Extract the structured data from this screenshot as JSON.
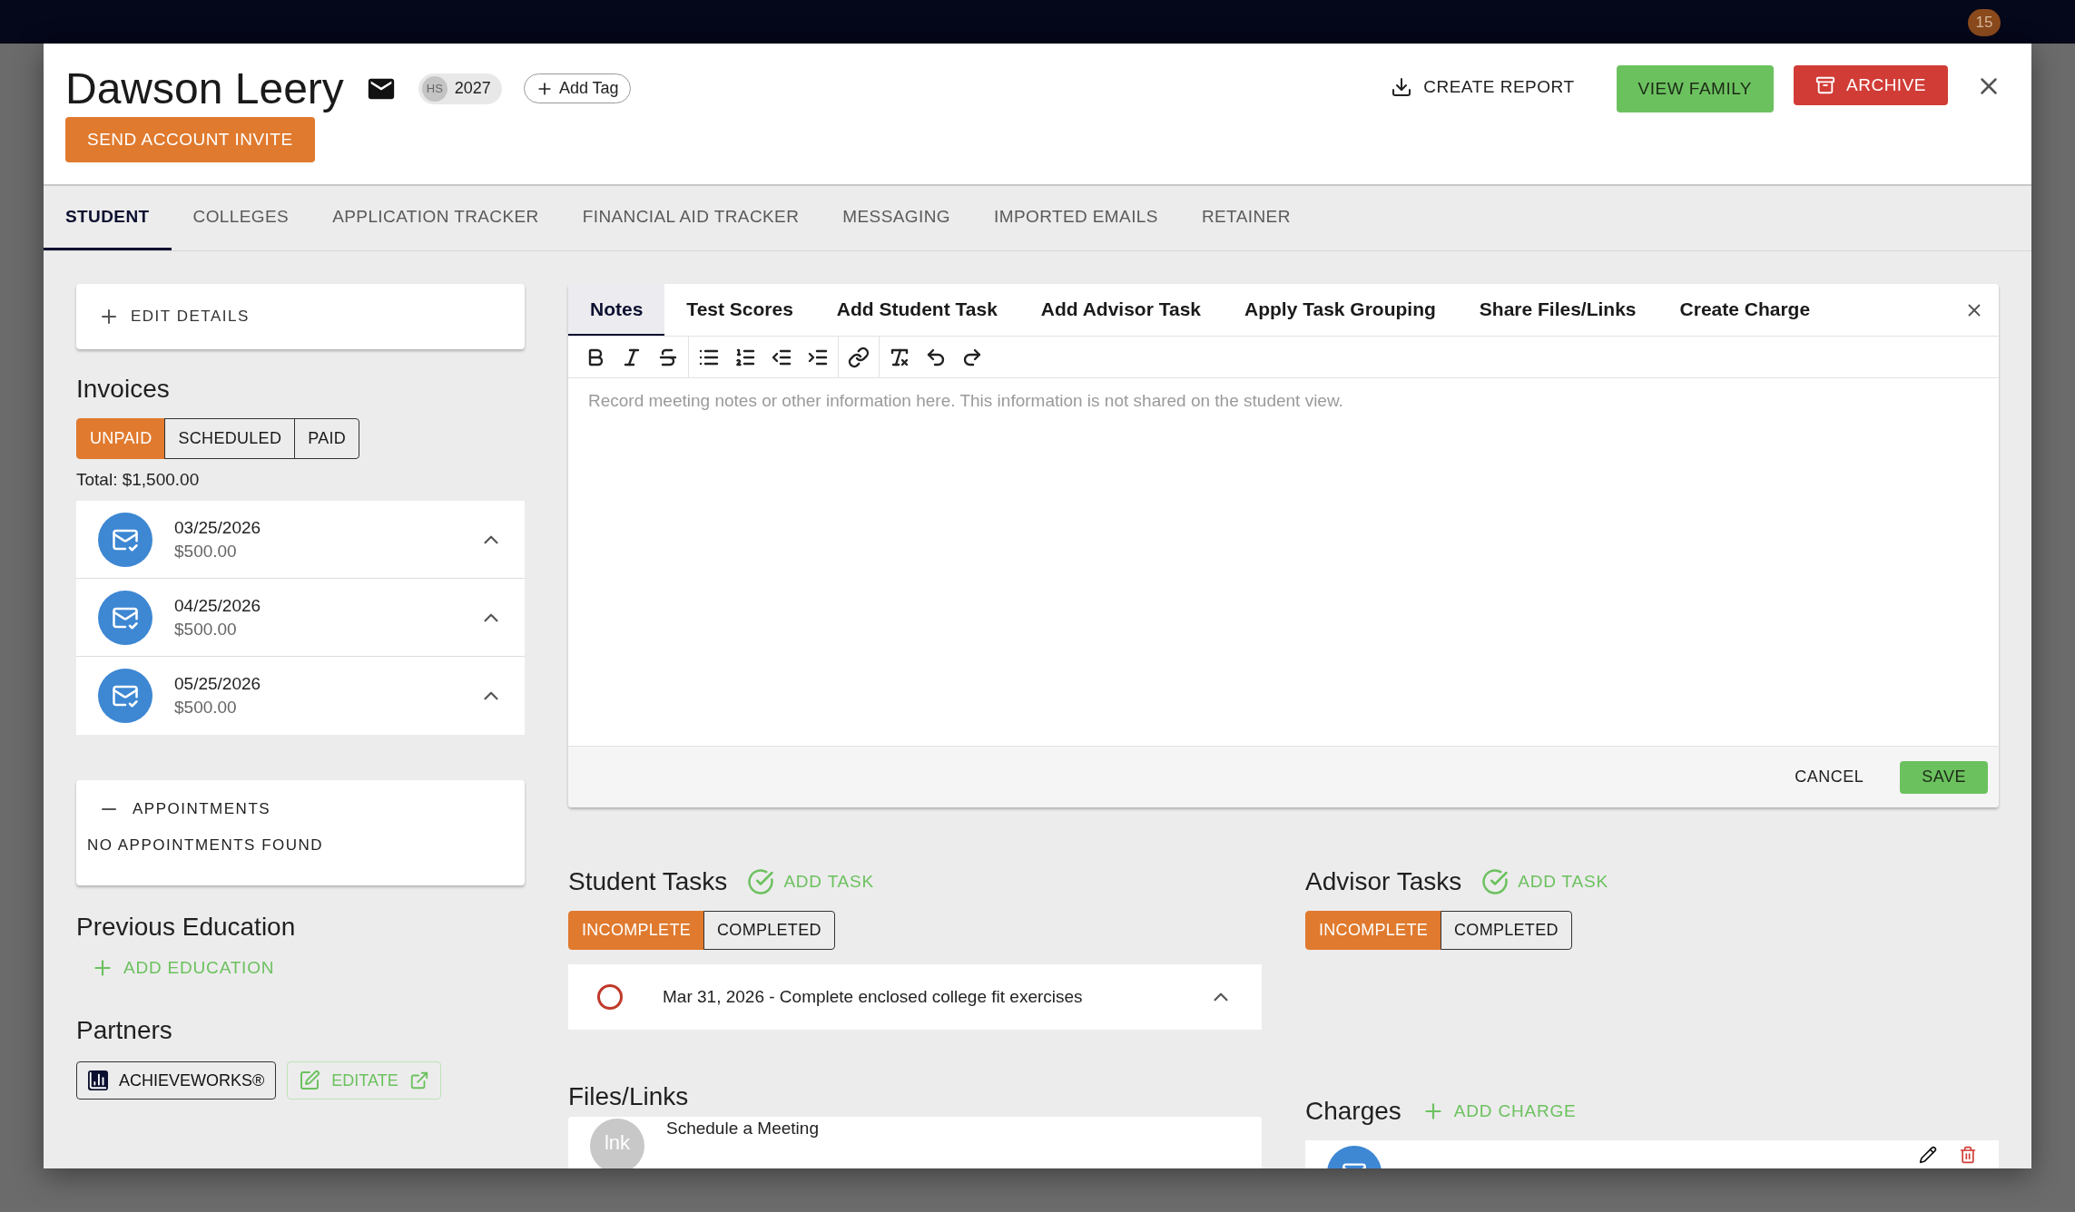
{
  "app_bar": {
    "notification_count": "15"
  },
  "student": {
    "name": "Dawson Leery",
    "class_chip": {
      "avatar": "HS",
      "year": "2027"
    },
    "add_tag": "Add Tag",
    "send_invite": "SEND ACCOUNT INVITE"
  },
  "header_actions": {
    "create_report": "CREATE REPORT",
    "view_family": "VIEW FAMILY",
    "archive": "ARCHIVE"
  },
  "tabs": [
    {
      "label": "STUDENT",
      "selected": true
    },
    {
      "label": "COLLEGES",
      "selected": false
    },
    {
      "label": "APPLICATION TRACKER",
      "selected": false
    },
    {
      "label": "FINANCIAL AID TRACKER",
      "selected": false
    },
    {
      "label": "MESSAGING",
      "selected": false
    },
    {
      "label": "IMPORTED EMAILS",
      "selected": false
    },
    {
      "label": "RETAINER",
      "selected": false
    }
  ],
  "edit_details": "EDIT DETAILS",
  "invoices": {
    "title": "Invoices",
    "filters": [
      {
        "label": "UNPAID",
        "selected": true
      },
      {
        "label": "SCHEDULED",
        "selected": false
      },
      {
        "label": "PAID",
        "selected": false
      }
    ],
    "total": "Total: $1,500.00",
    "items": [
      {
        "date": "03/25/2026",
        "amount": "$500.00"
      },
      {
        "date": "04/25/2026",
        "amount": "$500.00"
      },
      {
        "date": "05/25/2026",
        "amount": "$500.00"
      }
    ]
  },
  "appointments": {
    "title": "APPOINTMENTS",
    "empty": "NO APPOINTMENTS FOUND"
  },
  "previous_education": {
    "title": "Previous Education",
    "add": "ADD EDUCATION"
  },
  "partners": {
    "title": "Partners",
    "items": [
      {
        "kind": "chart",
        "label": "ACHIEVEWORKS®"
      },
      {
        "kind": "external",
        "label": "EDITATE"
      }
    ]
  },
  "editor": {
    "tabs": [
      {
        "label": "Notes",
        "selected": true
      },
      {
        "label": "Test Scores",
        "selected": false
      },
      {
        "label": "Add Student Task",
        "selected": false
      },
      {
        "label": "Add Advisor Task",
        "selected": false
      },
      {
        "label": "Apply Task Grouping",
        "selected": false
      },
      {
        "label": "Share Files/Links",
        "selected": false
      },
      {
        "label": "Create Charge",
        "selected": false
      }
    ],
    "placeholder": "Record meeting notes or other information here. This information is not shared on the student view.",
    "cancel": "CANCEL",
    "save": "SAVE"
  },
  "student_tasks": {
    "title": "Student Tasks",
    "add": "ADD TASK",
    "filters": [
      {
        "label": "INCOMPLETE",
        "selected": true
      },
      {
        "label": "COMPLETED",
        "selected": false
      }
    ],
    "items": [
      {
        "text": "Mar 31, 2026 - Complete enclosed college fit exercises",
        "completed": false
      }
    ]
  },
  "advisor_tasks": {
    "title": "Advisor Tasks",
    "add": "ADD TASK",
    "filters": [
      {
        "label": "INCOMPLETE",
        "selected": true
      },
      {
        "label": "COMPLETED",
        "selected": false
      }
    ]
  },
  "files_links": {
    "title": "Files/Links",
    "items": [
      {
        "avatar": "lnk",
        "label": "Schedule a Meeting"
      }
    ]
  },
  "charges": {
    "title": "Charges",
    "add": "ADD CHARGE"
  }
}
